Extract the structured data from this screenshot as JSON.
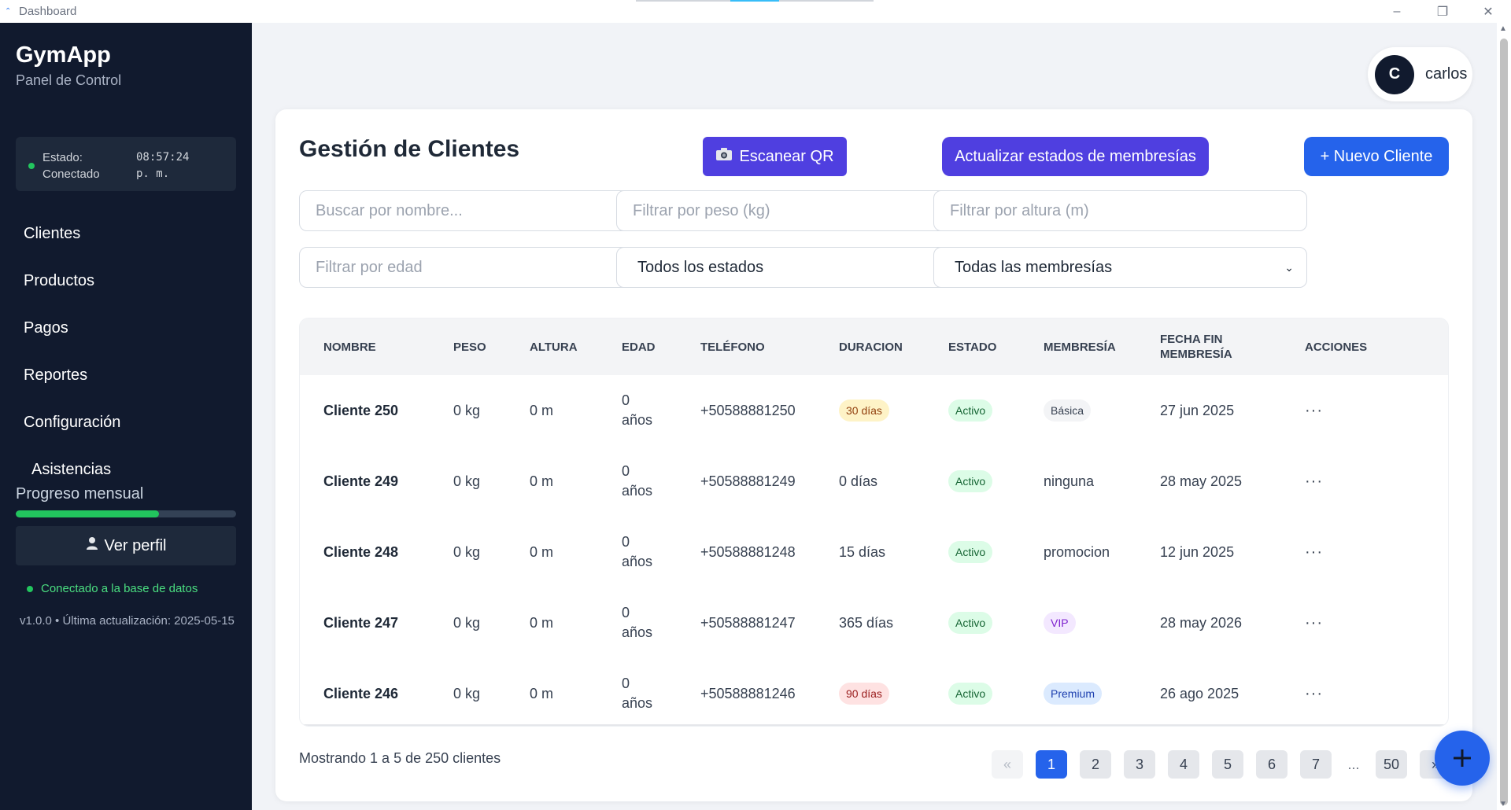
{
  "window": {
    "title": "Dashboard",
    "minimize_icon": "minimize-icon",
    "maximize_icon": "restore-icon",
    "close_icon": "close-icon"
  },
  "sidebar": {
    "brand": "GymApp",
    "subtitle": "Panel de Control",
    "status": {
      "label_line1": "Estado:",
      "label_line2": "Conectado",
      "time_line1": "08:57:24",
      "time_line2": "p. m.",
      "dot_color": "#22c55e"
    },
    "items": [
      {
        "label": "Clientes"
      },
      {
        "label": "Productos"
      },
      {
        "label": "Pagos"
      },
      {
        "label": "Reportes"
      },
      {
        "label": "Configuración"
      },
      {
        "label": "Asistencias"
      }
    ],
    "progress": {
      "label": "Progreso mensual",
      "value": 0.65,
      "color": "#22c55e"
    },
    "profile_button": "Ver perfil",
    "profile_icon": "user-icon",
    "db_status": "Conectado a la base de datos",
    "version": "v1.0.0 • Última actualización: 2025-05-15",
    "background": "#111a2e"
  },
  "user": {
    "initial": "C",
    "name": "carlos"
  },
  "main": {
    "title": "Gestión de Clientes",
    "buttons": {
      "scan_qr": "Escanear QR",
      "scan_qr_icon": "camera-icon",
      "update_memberships": "Actualizar estados de membresías",
      "new_client": "+ Nuevo Cliente"
    },
    "filters": {
      "search_placeholder": "Buscar por nombre...",
      "weight_placeholder": "Filtrar por peso (kg)",
      "height_placeholder": "Filtrar por altura (m)",
      "age_placeholder": "Filtrar por edad",
      "status_selected": "Todos los estados",
      "membership_selected": "Todas las membresías"
    },
    "table": {
      "headers": {
        "name": "NOMBRE",
        "weight": "PESO",
        "height": "ALTURA",
        "age": "EDAD",
        "phone": "TELÉFONO",
        "duration": "DURACION",
        "status": "ESTADO",
        "membership": "MEMBRESÍA",
        "end_date_1": "FECHA FIN",
        "end_date_2": "MEMBRESÍA",
        "actions": "ACCIONES"
      },
      "rows": [
        {
          "name": "Cliente 250",
          "weight": "0 kg",
          "height": "0 m",
          "age_num": "0",
          "age_unit": "años",
          "phone": "+50588881250",
          "duration": "30 días",
          "duration_style": "yellow",
          "status": "Activo",
          "membership": "Básica",
          "membership_style": "gray",
          "end_date": "27 jun 2025",
          "actions": "···"
        },
        {
          "name": "Cliente 249",
          "weight": "0 kg",
          "height": "0 m",
          "age_num": "0",
          "age_unit": "años",
          "phone": "+50588881249",
          "duration": "0 días",
          "duration_style": "plain",
          "status": "Activo",
          "membership": "ninguna",
          "membership_style": "plain",
          "end_date": "28 may 2025",
          "actions": "···"
        },
        {
          "name": "Cliente 248",
          "weight": "0 kg",
          "height": "0 m",
          "age_num": "0",
          "age_unit": "años",
          "phone": "+50588881248",
          "duration": "15 días",
          "duration_style": "plain",
          "status": "Activo",
          "membership": "promocion",
          "membership_style": "plain",
          "end_date": "12 jun 2025",
          "actions": "···"
        },
        {
          "name": "Cliente 247",
          "weight": "0 kg",
          "height": "0 m",
          "age_num": "0",
          "age_unit": "años",
          "phone": "+50588881247",
          "duration": "365 días",
          "duration_style": "plain",
          "status": "Activo",
          "membership": "VIP",
          "membership_style": "purple",
          "end_date": "28 may 2026",
          "actions": "···"
        },
        {
          "name": "Cliente 246",
          "weight": "0 kg",
          "height": "0 m",
          "age_num": "0",
          "age_unit": "años",
          "phone": "+50588881246",
          "duration": "90 días",
          "duration_style": "red",
          "status": "Activo",
          "membership": "Premium",
          "membership_style": "blue",
          "end_date": "26 ago 2025",
          "actions": "···"
        }
      ]
    },
    "pagination": {
      "summary": "Mostrando 1 a 5 de 250 clientes",
      "prev": "«",
      "pages": [
        "1",
        "2",
        "3",
        "4",
        "5",
        "6",
        "7"
      ],
      "ellipsis": "...",
      "last": "50",
      "next": "»",
      "active_page": "1"
    },
    "fab_icon": "plus-icon",
    "colors": {
      "primary": "#2563eb",
      "indigo": "#4f3fe0",
      "success": "#22c55e"
    }
  }
}
